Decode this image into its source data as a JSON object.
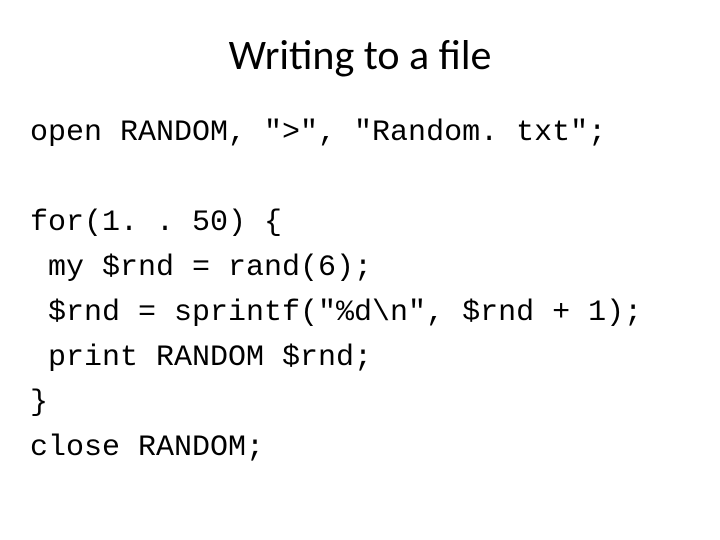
{
  "title": "Writing to a file",
  "code": {
    "l1": "open RANDOM, \">\", \"Random. txt\";",
    "l2": "",
    "l3": "for(1. . 50) {",
    "l4": " my $rnd = rand(6);",
    "l5": " $rnd = sprintf(\"%d\\n\", $rnd + 1);",
    "l6": " print RANDOM $rnd;",
    "l7": "}",
    "l8": "close RANDOM;"
  }
}
